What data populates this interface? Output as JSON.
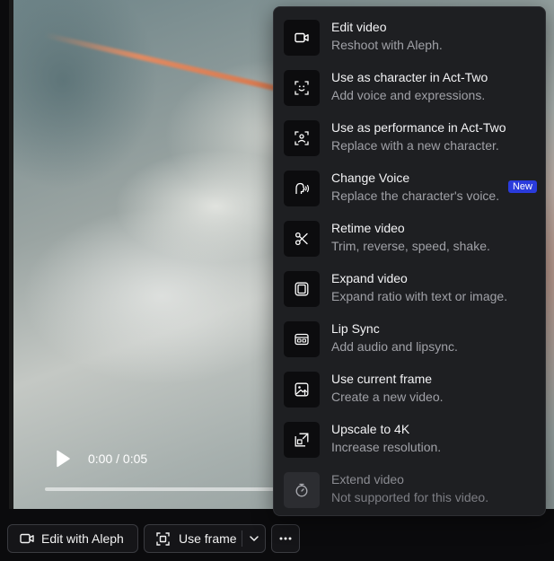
{
  "player": {
    "time": "0:00 / 0:05",
    "progress_percent": 0
  },
  "menu": {
    "items": [
      {
        "title": "Edit video",
        "desc": "Reshoot with Aleph.",
        "icon": "video-camera-icon"
      },
      {
        "title": "Use as character in Act-Two",
        "desc": "Add voice and expressions.",
        "icon": "face-scan-icon"
      },
      {
        "title": "Use as performance in Act-Two",
        "desc": "Replace with a new character.",
        "icon": "person-scan-icon"
      },
      {
        "title": "Change Voice",
        "desc": "Replace the character's voice.",
        "icon": "voice-head-icon",
        "badge": "New"
      },
      {
        "title": "Retime video",
        "desc": "Trim, reverse, speed, shake.",
        "icon": "scissors-icon"
      },
      {
        "title": "Expand video",
        "desc": "Expand ratio with text or image.",
        "icon": "expand-frame-icon"
      },
      {
        "title": "Lip Sync",
        "desc": "Add audio and lipsync.",
        "icon": "lip-sync-icon"
      },
      {
        "title": "Use current frame",
        "desc": "Create a new video.",
        "icon": "image-frame-icon"
      },
      {
        "title": "Upscale to 4K",
        "desc": "Increase resolution.",
        "icon": "upscale-icon"
      },
      {
        "title": "Extend video",
        "desc": "Not supported for this video.",
        "icon": "stopwatch-icon",
        "disabled": true
      }
    ]
  },
  "toolbar": {
    "edit_label": "Edit with Aleph",
    "frame_label": "Use frame"
  },
  "colors": {
    "menu_bg": "#1e1f22",
    "badge": "#2a3bdc"
  }
}
